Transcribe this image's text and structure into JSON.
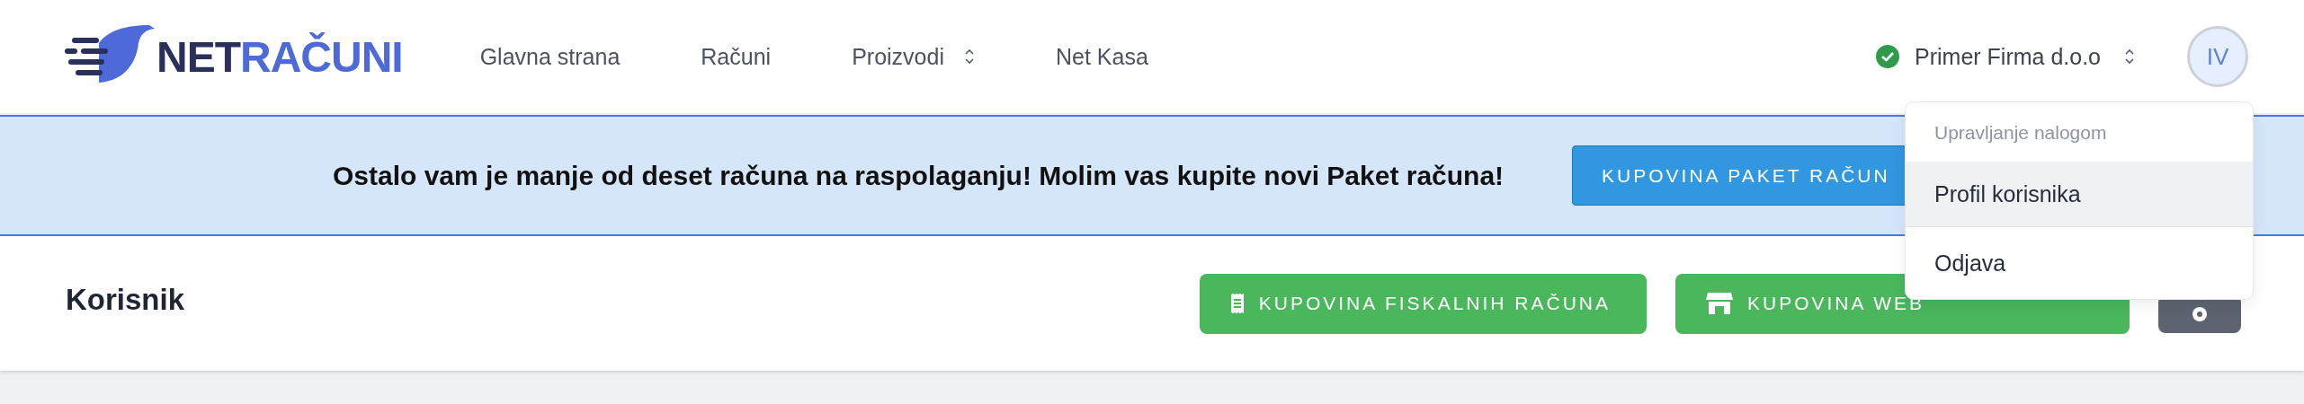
{
  "header": {
    "logo": {
      "dark": "NET",
      "accent": "RAČUNI"
    },
    "nav": [
      {
        "label": "Glavna strana",
        "dropdown": false
      },
      {
        "label": "Računi",
        "dropdown": false
      },
      {
        "label": "Proizvodi",
        "dropdown": true
      },
      {
        "label": "Net Kasa",
        "dropdown": false
      }
    ],
    "company": {
      "name": "Primer Firma d.o.o",
      "verified": true
    },
    "avatar": "IV"
  },
  "banner": {
    "message": "Ostalo vam je manje od deset računa na raspolaganju! Molim vas kupite novi Paket računa!",
    "button": "KUPOVINA PAKET RAČUN"
  },
  "page": {
    "title": "Korisnik",
    "buttons": [
      {
        "kind": "receipt",
        "label": "KUPOVINA FISKALNIH RAČUNA"
      },
      {
        "kind": "shop",
        "label": "KUPOVINA WEB"
      },
      {
        "kind": "gear"
      }
    ]
  },
  "account_menu": {
    "heading": "Upravljanje nalogom",
    "items": [
      {
        "label": "Profil korisnika",
        "selected": true
      },
      {
        "label": "Odjava",
        "selected": false
      }
    ]
  }
}
